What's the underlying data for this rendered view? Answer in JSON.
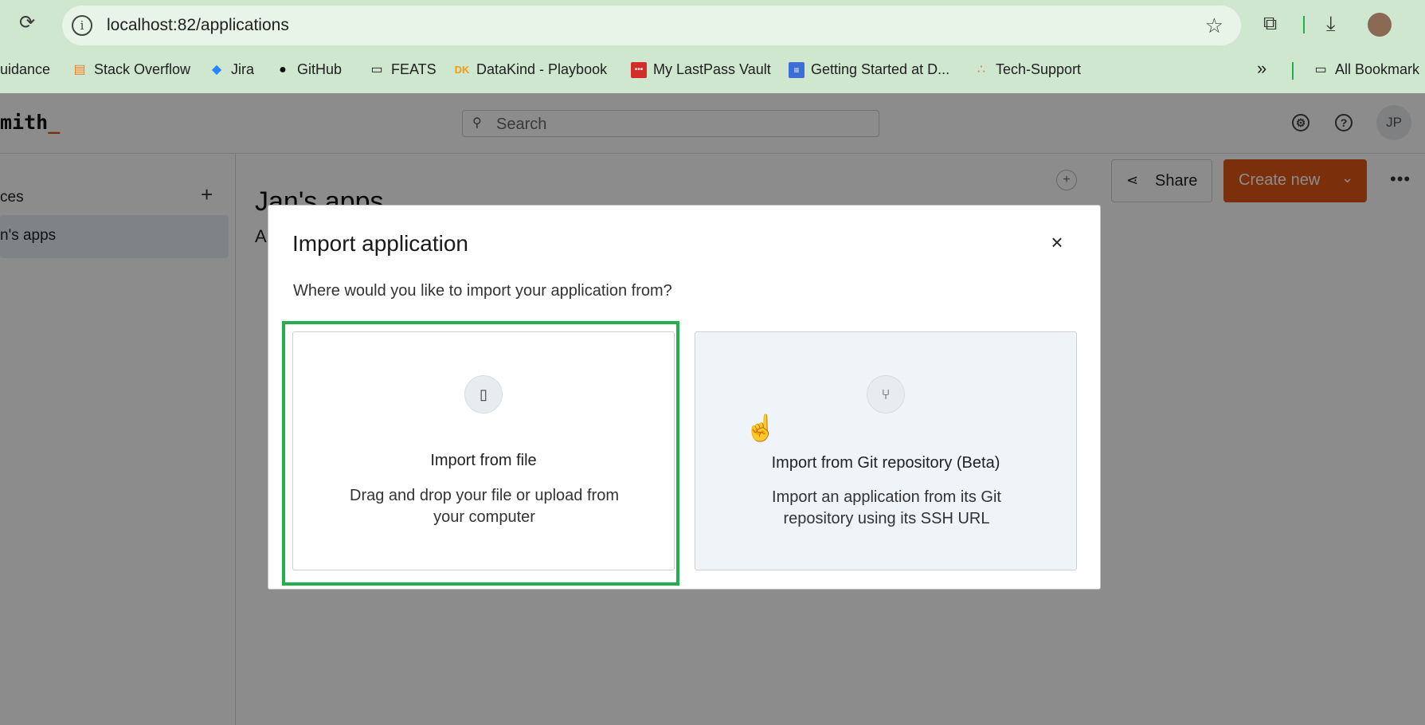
{
  "browser": {
    "url": "localhost:82/applications",
    "bookmarks": [
      {
        "label": "uidance",
        "icon": "bookmark-icon"
      },
      {
        "label": "Stack Overflow",
        "icon": "stackoverflow-icon"
      },
      {
        "label": "Jira",
        "icon": "jira-icon"
      },
      {
        "label": "GitHub",
        "icon": "github-icon"
      },
      {
        "label": "FEATS",
        "icon": "folder-icon"
      },
      {
        "label": "DataKind - Playbook",
        "icon": "datakind-icon"
      },
      {
        "label": "My LastPass Vault",
        "icon": "lastpass-icon"
      },
      {
        "label": "Getting Started at D...",
        "icon": "doc-icon"
      },
      {
        "label": "Tech-Support",
        "icon": "asana-icon"
      }
    ],
    "more_bookmarks": "»",
    "all_bookmarks": "All Bookmark"
  },
  "app": {
    "logo": "mith",
    "logo_cursor": "_",
    "search_placeholder": "Search",
    "avatar_initials": "JP",
    "sidebar": {
      "title": "ces",
      "add": "+",
      "workspace": "n's apps"
    },
    "page_title": "Jan's apps",
    "sub_letter": "A",
    "share_label": "Share",
    "create_label": "Create new"
  },
  "modal": {
    "title": "Import application",
    "close": "×",
    "subtitle": "Where would you like to import your application from?",
    "options": [
      {
        "title": "Import from file",
        "description": "Drag and drop your file or upload from your computer",
        "icon": "file-icon"
      },
      {
        "title": "Import from Git repository (Beta)",
        "description": "Import an application from its Git repository using its SSH URL",
        "icon": "git-branch-icon"
      }
    ]
  },
  "colors": {
    "accent": "#e15615",
    "highlight": "#21b04b",
    "chrome": "#cfe6cf"
  }
}
